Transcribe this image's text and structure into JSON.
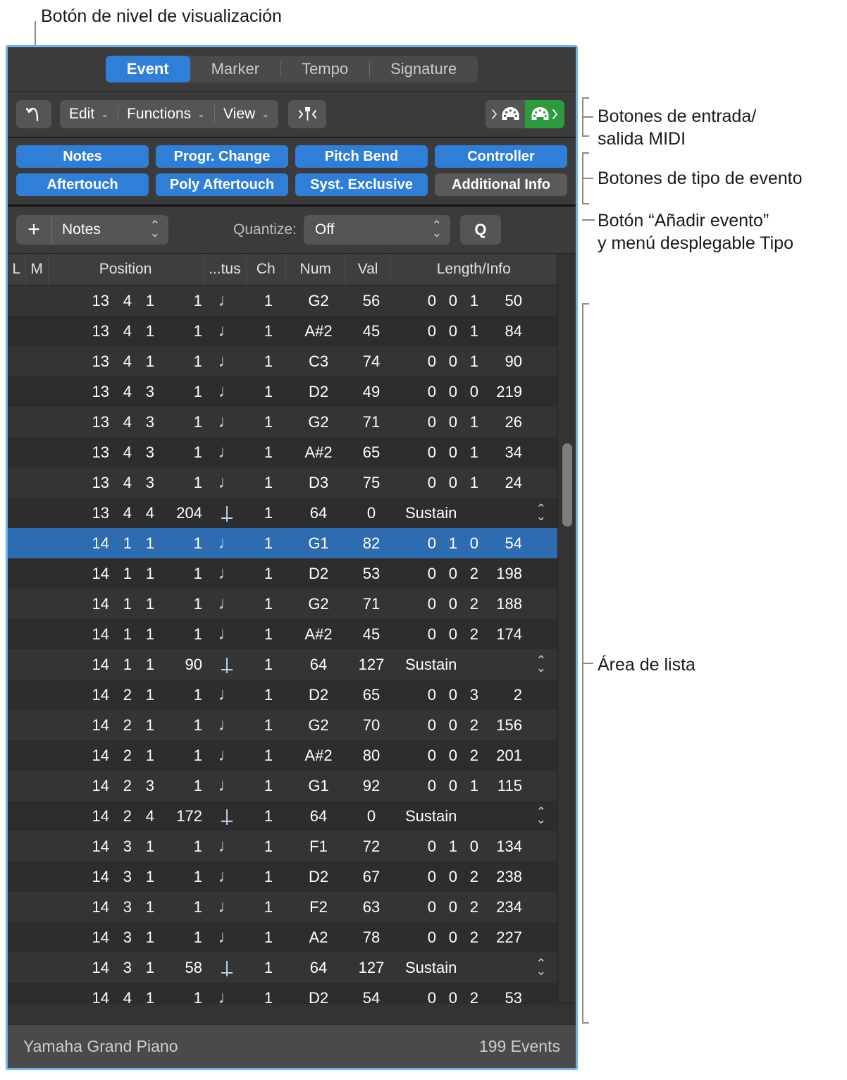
{
  "callouts": {
    "display_level": "Botón de nivel de visualización",
    "midi_io": "Botones de entrada/\nsalida MIDI",
    "event_type": "Botones de tipo de evento",
    "add_event": "Botón “Añadir evento”\ny menú desplegable Tipo",
    "list_area": "Área de lista"
  },
  "colors": {
    "accent_blue": "#2f7ed8",
    "selection_blue": "#2d6cb0",
    "midi_out_green": "#2d9c3f",
    "window_border": "#6db3f2"
  },
  "tabs": [
    {
      "label": "Event",
      "active": true
    },
    {
      "label": "Marker",
      "active": false
    },
    {
      "label": "Tempo",
      "active": false
    },
    {
      "label": "Signature",
      "active": false
    }
  ],
  "toolbar": {
    "level_up_icon": "hook-arrow-up-icon",
    "menus": [
      {
        "label": "Edit"
      },
      {
        "label": "Functions"
      },
      {
        "label": "View"
      }
    ],
    "chevron": "⌄",
    "catch_icon": "catch-playhead-icon",
    "midi_in_icon": "midi-in-icon",
    "midi_out_icon": "midi-out-icon"
  },
  "event_types": [
    [
      {
        "label": "Notes",
        "on": true
      },
      {
        "label": "Progr. Change",
        "on": true
      },
      {
        "label": "Pitch Bend",
        "on": true
      },
      {
        "label": "Controller",
        "on": true
      }
    ],
    [
      {
        "label": "Aftertouch",
        "on": true
      },
      {
        "label": "Poly Aftertouch",
        "on": true
      },
      {
        "label": "Syst. Exclusive",
        "on": true
      },
      {
        "label": "Additional Info",
        "on": false
      }
    ]
  ],
  "addbar": {
    "plus_label": "+",
    "type_value": "Notes",
    "quantize_label": "Quantize:",
    "quantize_value": "Off",
    "q_button_label": "Q"
  },
  "list": {
    "headers": [
      "L",
      "M",
      "Position",
      "...tus",
      "Ch",
      "Num",
      "Val",
      "Length/Info"
    ],
    "rows": [
      {
        "pos": [
          "13",
          "4",
          "1",
          "1"
        ],
        "status": "note",
        "ch": "1",
        "num": "G2",
        "val": "56",
        "kind": "len",
        "len": [
          "0",
          "0",
          "1",
          "50"
        ],
        "selected": false
      },
      {
        "pos": [
          "13",
          "4",
          "1",
          "1"
        ],
        "status": "note",
        "ch": "1",
        "num": "A#2",
        "val": "45",
        "kind": "len",
        "len": [
          "0",
          "0",
          "1",
          "84"
        ],
        "selected": false
      },
      {
        "pos": [
          "13",
          "4",
          "1",
          "1"
        ],
        "status": "note",
        "ch": "1",
        "num": "C3",
        "val": "74",
        "kind": "len",
        "len": [
          "0",
          "0",
          "1",
          "90"
        ],
        "selected": false
      },
      {
        "pos": [
          "13",
          "4",
          "3",
          "1"
        ],
        "status": "note",
        "ch": "1",
        "num": "D2",
        "val": "49",
        "kind": "len",
        "len": [
          "0",
          "0",
          "0",
          "219"
        ],
        "selected": false
      },
      {
        "pos": [
          "13",
          "4",
          "3",
          "1"
        ],
        "status": "note",
        "ch": "1",
        "num": "G2",
        "val": "71",
        "kind": "len",
        "len": [
          "0",
          "0",
          "1",
          "26"
        ],
        "selected": false
      },
      {
        "pos": [
          "13",
          "4",
          "3",
          "1"
        ],
        "status": "note",
        "ch": "1",
        "num": "A#2",
        "val": "65",
        "kind": "len",
        "len": [
          "0",
          "0",
          "1",
          "34"
        ],
        "selected": false
      },
      {
        "pos": [
          "13",
          "4",
          "3",
          "1"
        ],
        "status": "note",
        "ch": "1",
        "num": "D3",
        "val": "75",
        "kind": "len",
        "len": [
          "0",
          "0",
          "1",
          "24"
        ],
        "selected": false
      },
      {
        "pos": [
          "13",
          "4",
          "4",
          "204"
        ],
        "status": "ctrl",
        "ch": "1",
        "num": "64",
        "val": "0",
        "kind": "info",
        "info": "Sustain",
        "selected": false
      },
      {
        "pos": [
          "14",
          "1",
          "1",
          "1"
        ],
        "status": "note",
        "ch": "1",
        "num": "G1",
        "val": "82",
        "kind": "len",
        "len": [
          "0",
          "1",
          "0",
          "54"
        ],
        "selected": true
      },
      {
        "pos": [
          "14",
          "1",
          "1",
          "1"
        ],
        "status": "note",
        "ch": "1",
        "num": "D2",
        "val": "53",
        "kind": "len",
        "len": [
          "0",
          "0",
          "2",
          "198"
        ],
        "selected": false
      },
      {
        "pos": [
          "14",
          "1",
          "1",
          "1"
        ],
        "status": "note",
        "ch": "1",
        "num": "G2",
        "val": "71",
        "kind": "len",
        "len": [
          "0",
          "0",
          "2",
          "188"
        ],
        "selected": false
      },
      {
        "pos": [
          "14",
          "1",
          "1",
          "1"
        ],
        "status": "note",
        "ch": "1",
        "num": "A#2",
        "val": "45",
        "kind": "len",
        "len": [
          "0",
          "0",
          "2",
          "174"
        ],
        "selected": false
      },
      {
        "pos": [
          "14",
          "1",
          "1",
          "90"
        ],
        "status": "ctrl",
        "ch": "1",
        "num": "64",
        "val": "127",
        "kind": "info",
        "info": "Sustain",
        "selected": false
      },
      {
        "pos": [
          "14",
          "2",
          "1",
          "1"
        ],
        "status": "note",
        "ch": "1",
        "num": "D2",
        "val": "65",
        "kind": "len",
        "len": [
          "0",
          "0",
          "3",
          "2"
        ],
        "selected": false
      },
      {
        "pos": [
          "14",
          "2",
          "1",
          "1"
        ],
        "status": "note",
        "ch": "1",
        "num": "G2",
        "val": "70",
        "kind": "len",
        "len": [
          "0",
          "0",
          "2",
          "156"
        ],
        "selected": false
      },
      {
        "pos": [
          "14",
          "2",
          "1",
          "1"
        ],
        "status": "note",
        "ch": "1",
        "num": "A#2",
        "val": "80",
        "kind": "len",
        "len": [
          "0",
          "0",
          "2",
          "201"
        ],
        "selected": false
      },
      {
        "pos": [
          "14",
          "2",
          "3",
          "1"
        ],
        "status": "note",
        "ch": "1",
        "num": "G1",
        "val": "92",
        "kind": "len",
        "len": [
          "0",
          "0",
          "1",
          "115"
        ],
        "selected": false
      },
      {
        "pos": [
          "14",
          "2",
          "4",
          "172"
        ],
        "status": "ctrl",
        "ch": "1",
        "num": "64",
        "val": "0",
        "kind": "info",
        "info": "Sustain",
        "selected": false
      },
      {
        "pos": [
          "14",
          "3",
          "1",
          "1"
        ],
        "status": "note",
        "ch": "1",
        "num": "F1",
        "val": "72",
        "kind": "len",
        "len": [
          "0",
          "1",
          "0",
          "134"
        ],
        "selected": false
      },
      {
        "pos": [
          "14",
          "3",
          "1",
          "1"
        ],
        "status": "note",
        "ch": "1",
        "num": "D2",
        "val": "67",
        "kind": "len",
        "len": [
          "0",
          "0",
          "2",
          "238"
        ],
        "selected": false
      },
      {
        "pos": [
          "14",
          "3",
          "1",
          "1"
        ],
        "status": "note",
        "ch": "1",
        "num": "F2",
        "val": "63",
        "kind": "len",
        "len": [
          "0",
          "0",
          "2",
          "234"
        ],
        "selected": false
      },
      {
        "pos": [
          "14",
          "3",
          "1",
          "1"
        ],
        "status": "note",
        "ch": "1",
        "num": "A2",
        "val": "78",
        "kind": "len",
        "len": [
          "0",
          "0",
          "2",
          "227"
        ],
        "selected": false
      },
      {
        "pos": [
          "14",
          "3",
          "1",
          "58"
        ],
        "status": "ctrl",
        "ch": "1",
        "num": "64",
        "val": "127",
        "kind": "info",
        "info": "Sustain",
        "selected": false
      },
      {
        "pos": [
          "14",
          "4",
          "1",
          "1"
        ],
        "status": "note",
        "ch": "1",
        "num": "D2",
        "val": "54",
        "kind": "len",
        "len": [
          "0",
          "0",
          "2",
          "53"
        ],
        "selected": false
      }
    ]
  },
  "statusbar": {
    "instrument": "Yamaha Grand Piano",
    "event_count": "199 Events"
  }
}
